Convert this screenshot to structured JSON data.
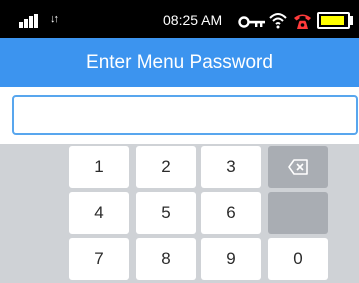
{
  "status_bar": {
    "time": "08:25 AM",
    "data_arrows": "↓↑",
    "icons": [
      "signal-icon",
      "data-arrows-icon",
      "key-icon",
      "wifi-icon",
      "missed-call-icon",
      "battery-icon"
    ]
  },
  "header": {
    "title": "Enter Menu Password"
  },
  "password_field": {
    "value": "",
    "placeholder": ""
  },
  "keypad": {
    "keys": [
      "1",
      "2",
      "3",
      "4",
      "5",
      "6",
      "7",
      "8",
      "9",
      "0"
    ],
    "backspace_icon": "backspace-icon"
  },
  "colors": {
    "status_bar": "#000000",
    "header": "#3c94ef",
    "input_border": "#58a6ee",
    "keypad_background": "#cfd2d6",
    "key_background": "#ffffff",
    "function_key": "#a9adb3",
    "battery": "#ffff00",
    "missed_call": "#ff3b3b"
  }
}
